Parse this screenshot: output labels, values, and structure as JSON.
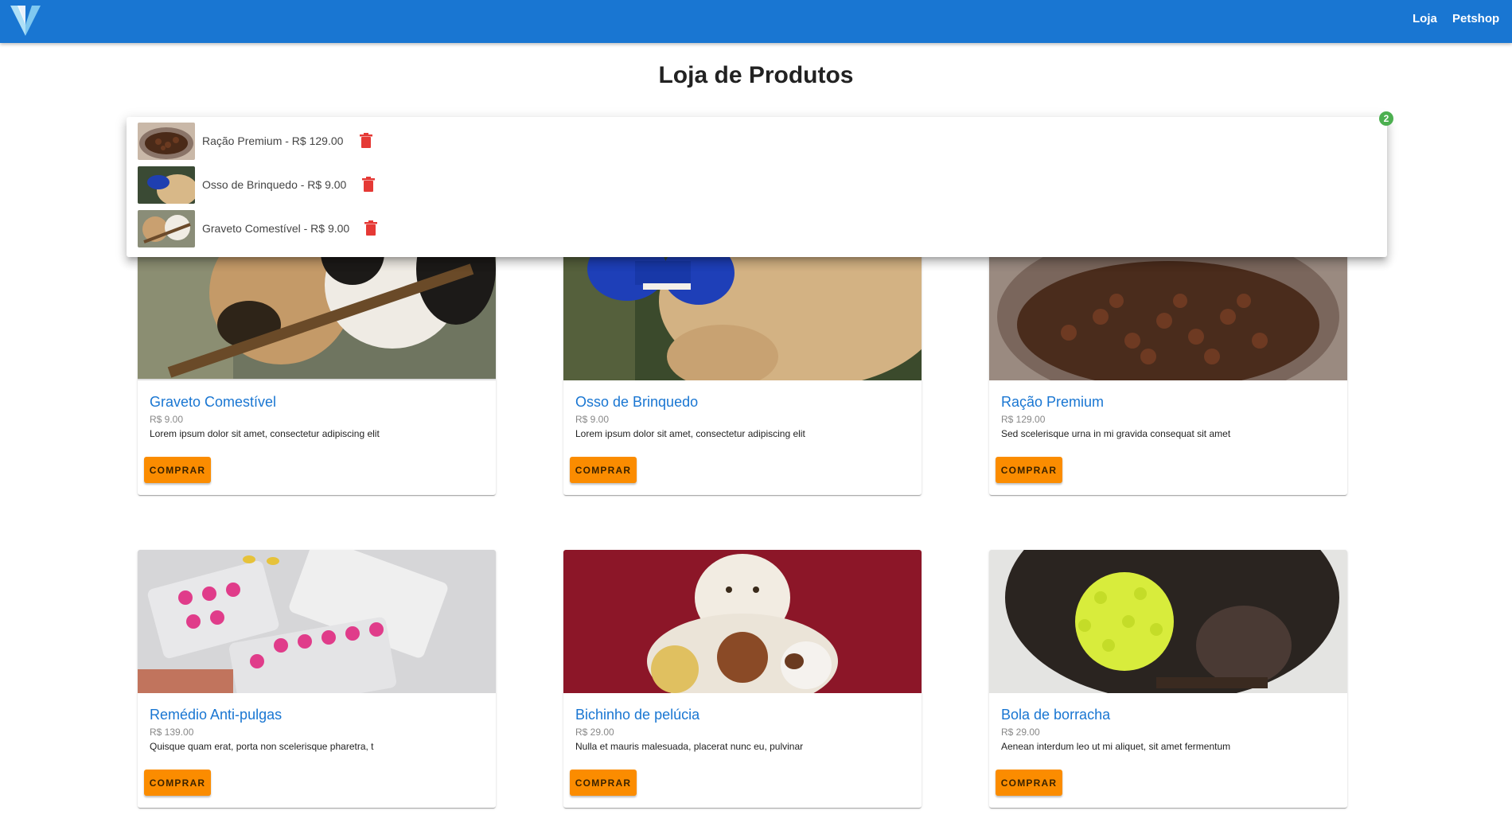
{
  "nav": {
    "logo": "vuetify-logo-icon",
    "links": [
      "Loja",
      "Petshop"
    ]
  },
  "page": {
    "title": "Loja de Produtos"
  },
  "cart": {
    "badge": "2",
    "items": [
      {
        "text": "Ração Premium - R$ 129.00",
        "thumb": "dog-food-bowl",
        "remove_icon": "trash-icon"
      },
      {
        "text": "Osso de Brinquedo - R$ 9.00",
        "thumb": "dog-with-blue-toy",
        "remove_icon": "trash-icon"
      },
      {
        "text": "Graveto Comestível - R$ 9.00",
        "thumb": "dogs-with-stick",
        "remove_icon": "trash-icon"
      }
    ]
  },
  "products": [
    {
      "name": "Graveto Comestível",
      "price": "R$ 9.00",
      "description": "Lorem ipsum dolor sit amet, consectetur adipiscing elit",
      "button": "COMPRAR",
      "image": "dogs-with-stick"
    },
    {
      "name": "Osso de Brinquedo",
      "price": "R$ 9.00",
      "description": "Lorem ipsum dolor sit amet, consectetur adipiscing elit",
      "button": "COMPRAR",
      "image": "dog-with-blue-toy"
    },
    {
      "name": "Ração Premium",
      "price": "R$ 129.00",
      "description": "Sed scelerisque urna in mi gravida consequat sit amet",
      "button": "COMPRAR",
      "image": "dog-food-bowl"
    },
    {
      "name": "Remédio Anti-pulgas",
      "price": "R$ 139.00",
      "description": "Quisque quam erat, porta non scelerisque pharetra, t",
      "button": "COMPRAR",
      "image": "pill-blisters"
    },
    {
      "name": "Bichinho de pelúcia",
      "price": "R$ 29.00",
      "description": "Nulla et mauris malesuada, placerat nunc eu, pulvinar",
      "button": "COMPRAR",
      "image": "plush-toys"
    },
    {
      "name": "Bola de borracha",
      "price": "R$ 29.00",
      "description": "Aenean interdum leo ut mi aliquet, sit amet fermentum",
      "button": "COMPRAR",
      "image": "dog-with-rubber-ball"
    }
  ],
  "colors": {
    "primary": "#1976d2",
    "button": "#fb8c00",
    "delete": "#e53935",
    "badge": "#4caf50"
  }
}
